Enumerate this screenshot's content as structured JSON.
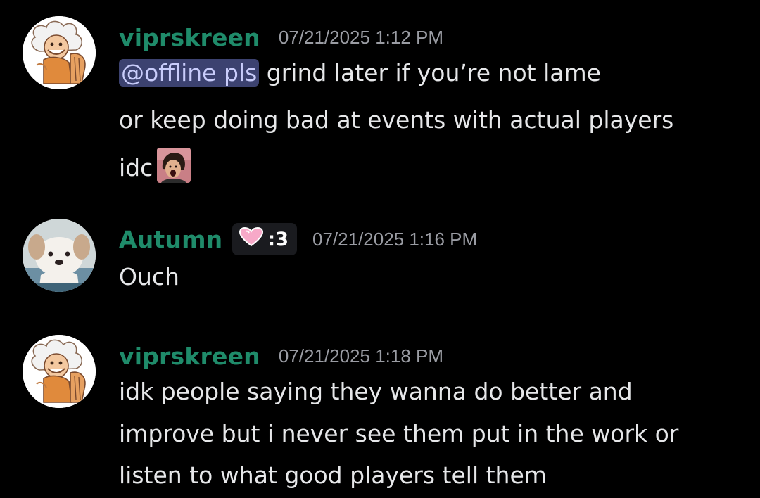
{
  "messages": [
    {
      "username": "viprskreen",
      "timestamp": "07/21/2025 1:12 PM",
      "mention": "@offline pls",
      "lines": [
        " grind later if you’re not lame",
        "or keep doing bad at events with actual players",
        "idc"
      ],
      "emoji": "shocked-face-emoji"
    },
    {
      "username": "Autumn",
      "tag_text": ":3",
      "tag_icon": "pink-heart-icon",
      "timestamp": "07/21/2025 1:16 PM",
      "lines": [
        "Ouch"
      ]
    },
    {
      "username": "viprskreen",
      "timestamp": "07/21/2025 1:18 PM",
      "lines": [
        "idk people saying they wanna do better and",
        "improve but i never see them put in the work or",
        "listen to what good players tell them"
      ]
    }
  ],
  "colors": {
    "background": "#000000",
    "username": "#1f8b6a",
    "timestamp": "#9a9ca3",
    "mention_bg": "#3c4270",
    "mention_text": "#c9cdfb",
    "text": "#e6e7e9"
  }
}
